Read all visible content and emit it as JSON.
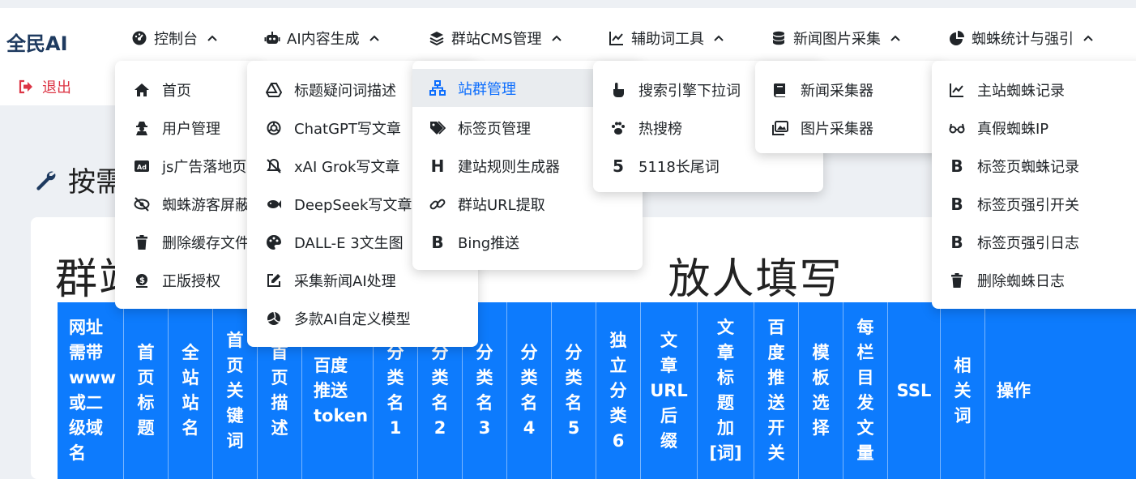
{
  "brand": "全民AI",
  "nav": [
    {
      "label": "控制台",
      "icon": "gauge-icon"
    },
    {
      "label": "AI内容生成",
      "icon": "robot-icon"
    },
    {
      "label": "群站CMS管理",
      "icon": "layers-icon"
    },
    {
      "label": "辅助词工具",
      "icon": "chart-line-icon"
    },
    {
      "label": "新闻图片采集",
      "icon": "database-icon"
    },
    {
      "label": "蜘蛛统计与强引",
      "icon": "pie-chart-icon"
    }
  ],
  "logout": "退出",
  "page_title": "按需",
  "card_title": "群站                                   放人填写",
  "menus": {
    "console": [
      "首页",
      "用户管理",
      "js广告落地页",
      "蜘蛛游客屏蔽",
      "删除缓存文件",
      "正版授权"
    ],
    "ai": [
      "标题疑问词描述",
      "ChatGPT写文章",
      "xAI Grok写文章",
      "DeepSeek写文章",
      "DALL-E 3文生图",
      "采集新闻AI处理",
      "多款AI自定义模型"
    ],
    "cms": [
      "站群管理",
      "标签页管理",
      "建站规则生成器",
      "群站URL提取",
      "Bing推送"
    ],
    "words": [
      "搜索引擎下拉词",
      "热搜榜",
      "5118长尾词"
    ],
    "news": [
      "新闻采集器",
      "图片采集器"
    ],
    "spider": [
      "主站蜘蛛记录",
      "真假蜘蛛IP",
      "标签页蜘蛛记录",
      "标签页强引开关",
      "标签页强引日志",
      "删除蜘蛛日志"
    ]
  },
  "table_headers": [
    "网址\n需带\nwww\n或二\n级域\n名",
    "首\n页\n标\n题",
    "全\n站\n站\n名",
    "首\n页\n关\n键\n词",
    "首\n页\n描\n述",
    "百度\n推送\ntoken",
    "分\n类\n名\n1",
    "分\n类\n名\n2",
    "分\n类\n名\n3",
    "分\n类\n名\n4",
    "分\n类\n名\n5",
    "独\n立\n分\n类\n6",
    "文\n章\nURL\n后\n缀",
    "文\n章\n标\n题\n加\n[词]",
    "百\n度\n推\n送\n开\n关",
    "模\n板\n选\n择",
    "每\n栏\n目\n发\n文\n量",
    "SSL",
    "相\n关\n词",
    "操作"
  ],
  "colors": {
    "brand": "#1e3a5f",
    "table_header": "#0d7bfd",
    "logout": "#dc3545",
    "active": "#0d6efd"
  }
}
